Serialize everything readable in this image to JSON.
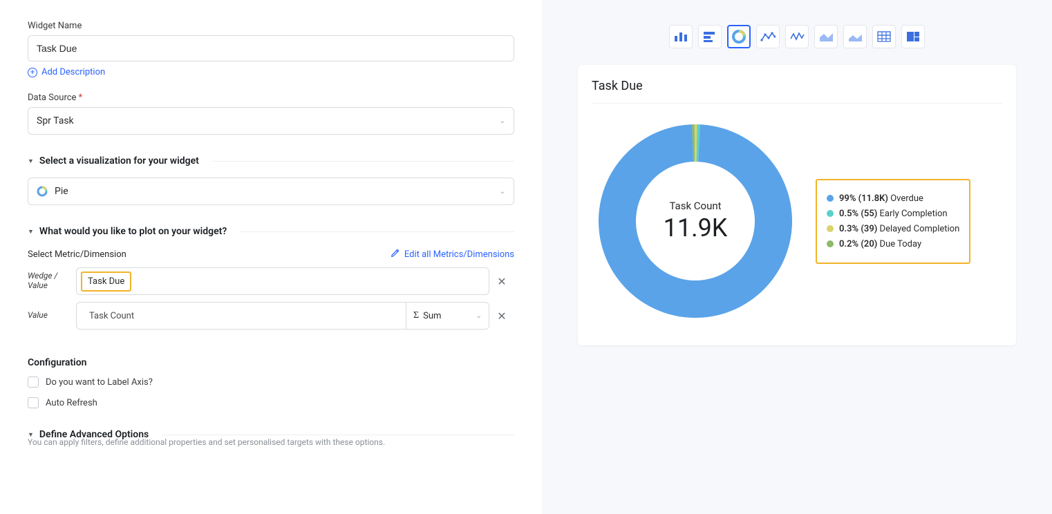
{
  "form": {
    "widget_name_label": "Widget Name",
    "widget_name_value": "Task Due",
    "add_description": "Add Description",
    "data_source_label": "Data Source",
    "data_source_value": "Spr Task"
  },
  "sections": {
    "visualization_header": "Select a visualization for your widget",
    "visualization_value": "Pie",
    "plot_header": "What would you like to plot on your widget?",
    "select_metric_label": "Select Metric/Dimension",
    "edit_all_link": "Edit all Metrics/Dimensions",
    "wedge_label_line1": "Wedge /",
    "wedge_label_line2": "Value",
    "wedge_value": "Task Due",
    "value_label": "Value",
    "value_value": "Task Count",
    "agg_label": "Sum",
    "config_heading": "Configuration",
    "checkbox_label_axis": "Do you want to Label Axis?",
    "checkbox_auto_refresh": "Auto Refresh",
    "advanced_header": "Define Advanced Options",
    "advanced_sub": "You can apply filters, define additional properties and set personalised targets with these options."
  },
  "preview": {
    "widget_title": "Task Due",
    "center_label": "Task Count",
    "center_value": "11.9K"
  },
  "legend": [
    {
      "pct": "99%",
      "count": "(11.8K)",
      "label": "Overdue",
      "color": "#5aa3e8"
    },
    {
      "pct": "0.5%",
      "count": "(55)",
      "label": "Early Completion",
      "color": "#5ad1c8"
    },
    {
      "pct": "0.3%",
      "count": "(39)",
      "label": "Delayed Completion",
      "color": "#d9d36a"
    },
    {
      "pct": "0.2%",
      "count": "(20)",
      "label": "Due Today",
      "color": "#8db96a"
    }
  ],
  "viz_types": [
    {
      "name": "column-chart-icon",
      "selected": false
    },
    {
      "name": "bar-chart-icon",
      "selected": false
    },
    {
      "name": "pie-chart-icon",
      "selected": true
    },
    {
      "name": "line-chart-icon",
      "selected": false
    },
    {
      "name": "spline-chart-icon",
      "selected": false
    },
    {
      "name": "area-chart-icon",
      "selected": false
    },
    {
      "name": "stacked-area-icon",
      "selected": false
    },
    {
      "name": "table-chart-icon",
      "selected": false
    },
    {
      "name": "treemap-chart-icon",
      "selected": false
    }
  ],
  "chart_data": {
    "type": "pie",
    "title": "Task Due",
    "metric": "Task Count",
    "total_display": "11.9K",
    "total_value": 11914,
    "series": [
      {
        "name": "Overdue",
        "value": 11800,
        "pct": 99.0,
        "color": "#5aa3e8"
      },
      {
        "name": "Early Completion",
        "value": 55,
        "pct": 0.5,
        "color": "#5ad1c8"
      },
      {
        "name": "Delayed Completion",
        "value": 39,
        "pct": 0.3,
        "color": "#d9d36a"
      },
      {
        "name": "Due Today",
        "value": 20,
        "pct": 0.2,
        "color": "#8db96a"
      }
    ]
  }
}
